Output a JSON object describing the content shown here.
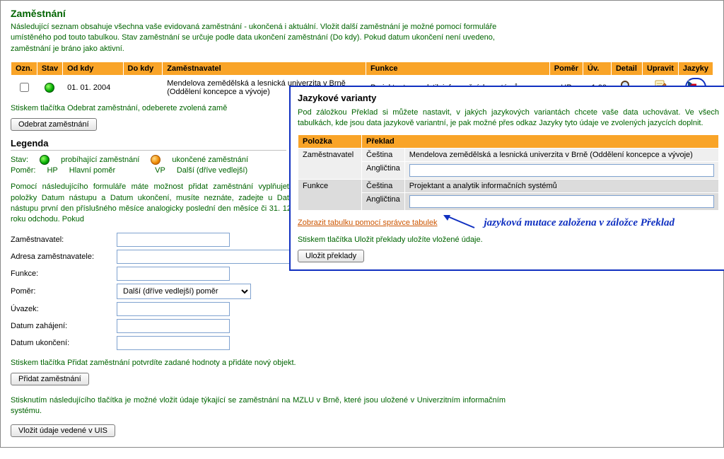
{
  "page": {
    "title": "Zaměstnání",
    "intro": "Následující seznam obsahuje všechna vaše evidovaná zaměstnání - ukončená i aktuální. Vložit další zaměstnání je možné pomocí formuláře umístěného pod touto tabulkou. Stav zaměstnání se určuje podle data ukončení zaměstnání (Do kdy). Pokud datum ukončení není uvedeno, zaměstnání je bráno jako aktivní."
  },
  "table": {
    "h_ozn": "Ozn.",
    "h_stav": "Stav",
    "h_odkdy": "Od kdy",
    "h_dokdy": "Do kdy",
    "h_zamest": "Zaměstnavatel",
    "h_funkce": "Funkce",
    "h_pomer": "Poměr",
    "h_uv": "Úv.",
    "h_detail": "Detail",
    "h_upravit": "Upravit",
    "h_jazyky": "Jazyky",
    "rows": [
      {
        "odkdy": "01. 01. 2004",
        "dokdy": "",
        "zamest": "Mendelova zemědělská a lesnická univerzita v Brně (Oddělení koncepce a vývoje)",
        "funkce": "Projektant a analytik informačních systémů",
        "pomer": "HP",
        "uv": "1,00"
      }
    ]
  },
  "notes": {
    "remove_hint": "Stiskem tlačítka Odebrat zaměstnání, odeberete zvolená zamě",
    "remove_btn": "Odebrat zaměstnání",
    "legend_title": "Legenda",
    "legend_stav": "Stav:",
    "legend_active": "probíhající zaměstnání",
    "legend_ended": "ukončené zaměstnání",
    "legend_pomer_label": "Poměr:",
    "legend_hp": "HP",
    "legend_hp_desc": "Hlavní poměr",
    "legend_vp": "VP",
    "legend_vp_desc": "Další (dříve vedlejší)",
    "form_intro": "Pomocí následujícího formuláře máte možnost přidat zaměstnání vyplňujete položky Datum nástupu a Datum ukončení, musíte neznáte, zadejte u Data nástupu první den příslušného měsíce analogicky poslední den měsíce či 31. 12. roku odchodu. Pokud",
    "confirm_hint": "Stiskem tlačítka Přidat zaměstnání potvrdíte zadané hodnoty a přidáte nový objekt.",
    "add_btn": "Přidat zaměstnání",
    "uis_hint": "Stisknutím následujícího tlačítka je možné vložit údaje týkající se zaměstnání na MZLU v Brně, které jsou uložené v Univerzitním informačním systému.",
    "uis_btn": "Vložit údaje vedené v UIS"
  },
  "form": {
    "l_zamest": "Zaměstnavatel:",
    "l_adresa": "Adresa zaměstnavatele:",
    "l_funkce": "Funkce:",
    "l_pomer": "Poměr:",
    "pomer_option": "Další (dříve vedlejší) poměr",
    "l_uvazek": "Úvazek:",
    "l_zahajeni": "Datum zahájení:",
    "l_ukonceni": "Datum ukončení:"
  },
  "overlay": {
    "title": "Jazykové varianty",
    "intro": "Pod záložkou Překlad si můžete nastavit, v jakých jazykových variantách chcete vaše data uchovávat. Ve všech tabulkách, kde jsou data jazykově variantní, je pak možné přes odkaz Jazyky tyto údaje ve zvolených jazycích doplnit.",
    "h_polozka": "Položka",
    "h_preklad": "Překlad",
    "r1_item": "Zaměstnavatel",
    "r1_cz_label": "Čeština",
    "r1_cz_value": "Mendelova zemědělská a lesnická univerzita v Brně (Oddělení koncepce a vývoje)",
    "r1_en_label": "Angličtina",
    "r1_en_value": "",
    "r2_item": "Funkce",
    "r2_cz_label": "Čeština",
    "r2_cz_value": "Projektant a analytik informačních systémů",
    "r2_en_label": "Angličtina",
    "r2_en_value": "",
    "link_tabulky": "Zobrazit tabulku pomocí správce tabulek",
    "save_hint": "Stiskem tlačítka Uložit překlady uložíte vložené údaje.",
    "save_btn": "Uložit překlady",
    "annot": "jazyková mutace založena v záložce Překlad"
  }
}
